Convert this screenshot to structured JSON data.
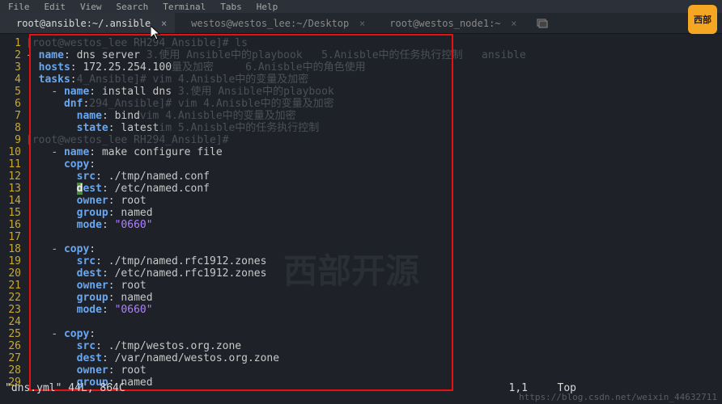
{
  "menu": [
    "File",
    "Edit",
    "View",
    "Search",
    "Terminal",
    "Tabs",
    "Help"
  ],
  "tabs": [
    {
      "title": "root@ansible:~/.ansible",
      "active": true
    },
    {
      "title": "westos@westos_lee:~/Desktop",
      "active": false
    },
    {
      "title": "root@westos_node1:~",
      "active": false
    }
  ],
  "code": {
    "lines": [
      {
        "n": 1,
        "ghost": "[root@westos_lee RH294_Ansible]# ls"
      },
      {
        "n": 2,
        "tokens": [
          [
            "dash",
            "- "
          ],
          [
            "key",
            "name"
          ],
          [
            "col",
            ": "
          ],
          [
            "str",
            "dns server"
          ]
        ],
        "ghost": " 3.使用 Ansible中的playbook   5.Anisble中的任务执行控制   ansible"
      },
      {
        "n": 3,
        "tokens": [
          [
            "plain",
            "  "
          ],
          [
            "key",
            "hosts"
          ],
          [
            "col",
            ": "
          ],
          [
            "str",
            "172.25.254.100"
          ]
        ],
        "ghost": "量及加密     6.Anisble中的角色使用"
      },
      {
        "n": 4,
        "tokens": [
          [
            "plain",
            "  "
          ],
          [
            "key",
            "tasks"
          ],
          [
            "col",
            ":"
          ]
        ],
        "ghost": "4_Ansible]# vim 4.Anisble中的变量及加密"
      },
      {
        "n": 5,
        "tokens": [
          [
            "plain",
            "    "
          ],
          [
            "dash",
            "- "
          ],
          [
            "key",
            "name"
          ],
          [
            "col",
            ": "
          ],
          [
            "str",
            "install dns"
          ]
        ],
        "ghost": " 3.使用 Ansible中的playbook"
      },
      {
        "n": 6,
        "tokens": [
          [
            "plain",
            "      "
          ],
          [
            "key",
            "dnf"
          ],
          [
            "col",
            ":"
          ]
        ],
        "ghost": "294_Ansible]# vim 4.Anisble中的变量及加密"
      },
      {
        "n": 7,
        "tokens": [
          [
            "plain",
            "        "
          ],
          [
            "key",
            "name"
          ],
          [
            "col",
            ": "
          ],
          [
            "str",
            "bind"
          ]
        ],
        "ghost": "vim 4.Anisble中的变量及加密"
      },
      {
        "n": 8,
        "tokens": [
          [
            "plain",
            "        "
          ],
          [
            "key",
            "state"
          ],
          [
            "col",
            ": "
          ],
          [
            "str",
            "latest"
          ]
        ],
        "ghost": "im 5.Anisble中的任务执行控制"
      },
      {
        "n": 9,
        "ghost": "[root@westos_lee RH294_Ansible]# "
      },
      {
        "n": 10,
        "tokens": [
          [
            "plain",
            "    "
          ],
          [
            "dash",
            "- "
          ],
          [
            "key",
            "name"
          ],
          [
            "col",
            ": "
          ],
          [
            "str",
            "make configure file"
          ]
        ]
      },
      {
        "n": 11,
        "tokens": [
          [
            "plain",
            "      "
          ],
          [
            "key",
            "copy"
          ],
          [
            "col",
            ":"
          ]
        ]
      },
      {
        "n": 12,
        "tokens": [
          [
            "plain",
            "        "
          ],
          [
            "key",
            "src"
          ],
          [
            "col",
            ": "
          ],
          [
            "str",
            "./tmp/named.conf"
          ]
        ]
      },
      {
        "n": 13,
        "tokens": [
          [
            "plain",
            "        "
          ],
          [
            "keyC",
            "d"
          ],
          [
            "key",
            "est"
          ],
          [
            "col",
            ": "
          ],
          [
            "str",
            "/etc/named.conf"
          ]
        ]
      },
      {
        "n": 14,
        "tokens": [
          [
            "plain",
            "        "
          ],
          [
            "key",
            "owner"
          ],
          [
            "col",
            ": "
          ],
          [
            "str",
            "root"
          ]
        ]
      },
      {
        "n": 15,
        "tokens": [
          [
            "plain",
            "        "
          ],
          [
            "key",
            "group"
          ],
          [
            "col",
            ": "
          ],
          [
            "str",
            "named"
          ]
        ]
      },
      {
        "n": 16,
        "tokens": [
          [
            "plain",
            "        "
          ],
          [
            "key",
            "mode"
          ],
          [
            "col",
            ": "
          ],
          [
            "quote",
            "\"0660\""
          ]
        ]
      },
      {
        "n": 17,
        "tokens": []
      },
      {
        "n": 18,
        "tokens": [
          [
            "plain",
            "    "
          ],
          [
            "dash",
            "- "
          ],
          [
            "key",
            "copy"
          ],
          [
            "col",
            ":"
          ]
        ]
      },
      {
        "n": 19,
        "tokens": [
          [
            "plain",
            "        "
          ],
          [
            "key",
            "src"
          ],
          [
            "col",
            ": "
          ],
          [
            "str",
            "./tmp/named.rfc1912.zones"
          ]
        ]
      },
      {
        "n": 20,
        "tokens": [
          [
            "plain",
            "        "
          ],
          [
            "key",
            "dest"
          ],
          [
            "col",
            ": "
          ],
          [
            "str",
            "/etc/named.rfc1912.zones"
          ]
        ]
      },
      {
        "n": 21,
        "tokens": [
          [
            "plain",
            "        "
          ],
          [
            "key",
            "owner"
          ],
          [
            "col",
            ": "
          ],
          [
            "str",
            "root"
          ]
        ]
      },
      {
        "n": 22,
        "tokens": [
          [
            "plain",
            "        "
          ],
          [
            "key",
            "group"
          ],
          [
            "col",
            ": "
          ],
          [
            "str",
            "named"
          ]
        ]
      },
      {
        "n": 23,
        "tokens": [
          [
            "plain",
            "        "
          ],
          [
            "key",
            "mode"
          ],
          [
            "col",
            ": "
          ],
          [
            "quote",
            "\"0660\""
          ]
        ]
      },
      {
        "n": 24,
        "tokens": []
      },
      {
        "n": 25,
        "tokens": [
          [
            "plain",
            "    "
          ],
          [
            "dash",
            "- "
          ],
          [
            "key",
            "copy"
          ],
          [
            "col",
            ":"
          ]
        ]
      },
      {
        "n": 26,
        "tokens": [
          [
            "plain",
            "        "
          ],
          [
            "key",
            "src"
          ],
          [
            "col",
            ": "
          ],
          [
            "str",
            "./tmp/westos.org.zone"
          ]
        ]
      },
      {
        "n": 27,
        "tokens": [
          [
            "plain",
            "        "
          ],
          [
            "key",
            "dest"
          ],
          [
            "col",
            ": "
          ],
          [
            "str",
            "/var/named/westos.org.zone"
          ]
        ]
      },
      {
        "n": 28,
        "tokens": [
          [
            "plain",
            "        "
          ],
          [
            "key",
            "owner"
          ],
          [
            "col",
            ": "
          ],
          [
            "str",
            "root"
          ]
        ]
      },
      {
        "n": 29,
        "tokens": [
          [
            "plain",
            "        "
          ],
          [
            "key",
            "group"
          ],
          [
            "col",
            ": "
          ],
          [
            "str",
            "named"
          ]
        ]
      }
    ]
  },
  "status": "\"dns.yml\" 44L, 864C",
  "pos": "1,1",
  "topp": "Top",
  "watermark_center": "西部开源",
  "watermark_url": "https://blog.csdn.net/weixin_44632711"
}
